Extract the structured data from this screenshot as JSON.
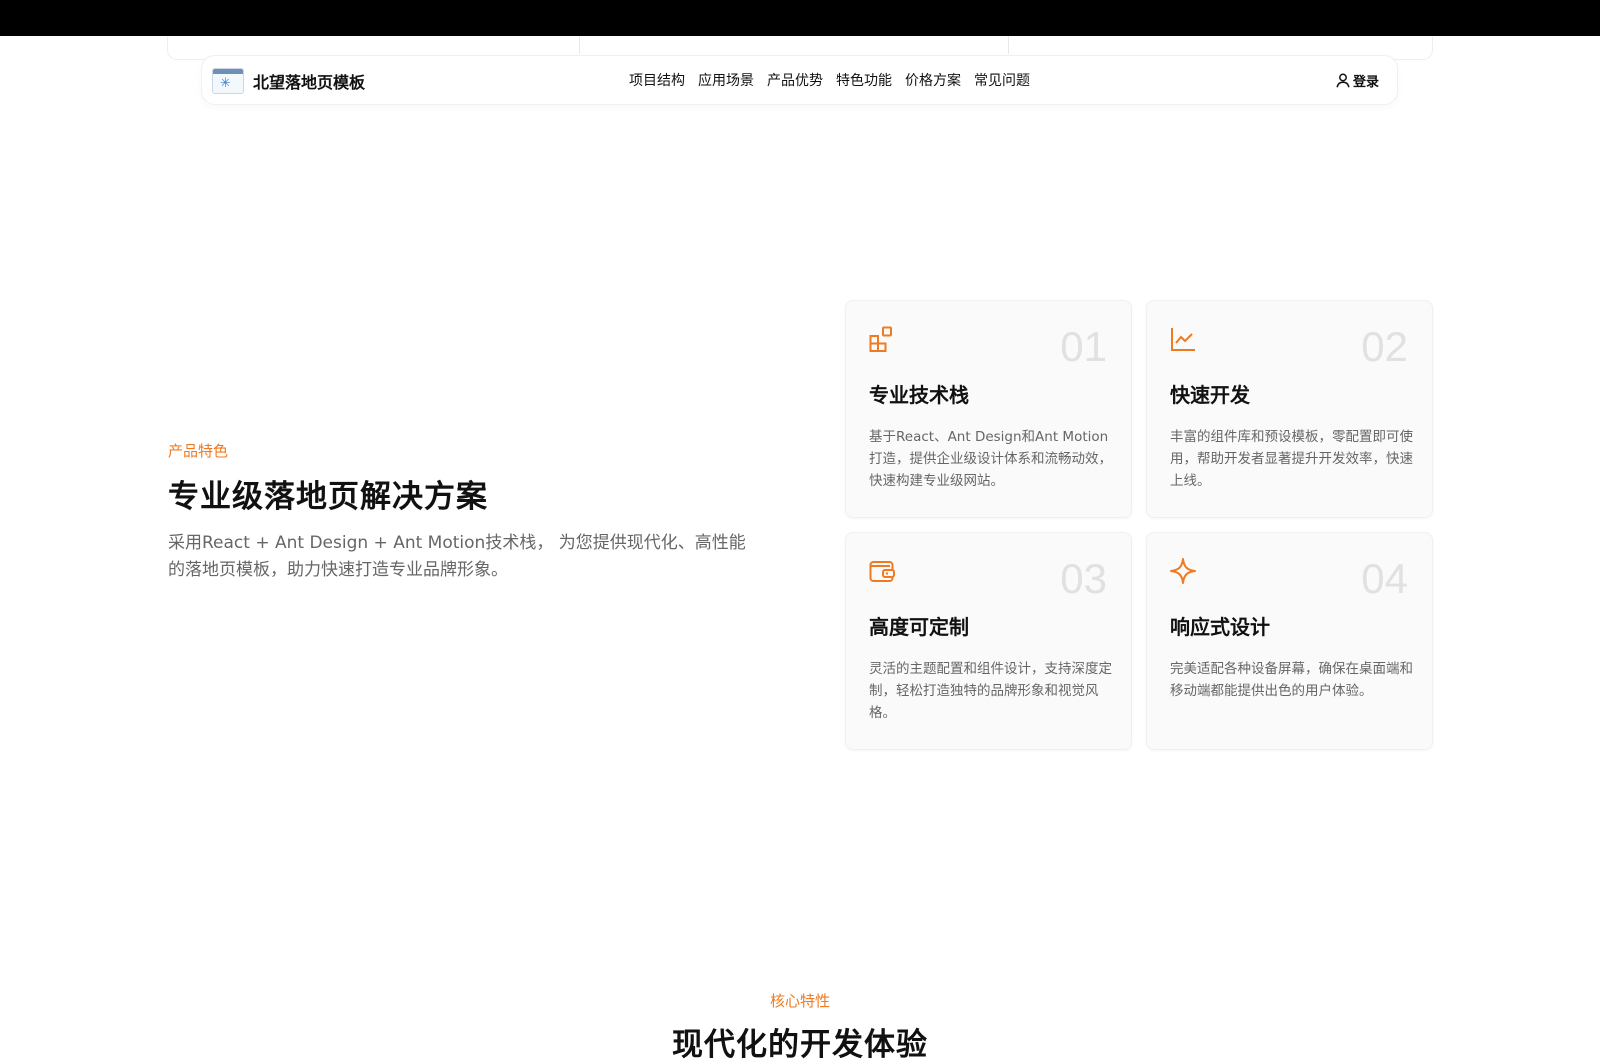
{
  "brand": {
    "name": "北望落地页模板"
  },
  "nav": {
    "links": [
      {
        "label": "项目结构"
      },
      {
        "label": "应用场景"
      },
      {
        "label": "产品优势"
      },
      {
        "label": "特色功能"
      },
      {
        "label": "价格方案"
      },
      {
        "label": "常见问题"
      }
    ],
    "login_label": "登录"
  },
  "features": {
    "eyebrow": "产品特色",
    "title": "专业级落地页解决方案",
    "description": "采用React + Ant Design + Ant Motion技术栈， 为您提供现代化、高性能的落地页模板，助力快速打造专业品牌形象。",
    "cards": [
      {
        "number": "01",
        "icon": "blocks-icon",
        "title": "专业技术栈",
        "description": "基于React、Ant Design和Ant Motion打造，提供企业级设计体系和流畅动效，快速构建专业级网站。"
      },
      {
        "number": "02",
        "icon": "line-chart-icon",
        "title": "快速开发",
        "description": "丰富的组件库和预设模板，零配置即可使用，帮助开发者显著提升开发效率，快速上线。"
      },
      {
        "number": "03",
        "icon": "wallet-icon",
        "title": "高度可定制",
        "description": "灵活的主题配置和组件设计，支持深度定制，轻松打造独特的品牌形象和视觉风格。"
      },
      {
        "number": "04",
        "icon": "sparkle-icon",
        "title": "响应式设计",
        "description": "完美适配各种设备屏幕，确保在桌面端和移动端都能提供出色的用户体验。"
      }
    ]
  },
  "core": {
    "eyebrow": "核心特性",
    "title": "现代化的开发体验"
  },
  "colors": {
    "accent": "#f07a21",
    "text": "#111111",
    "muted": "#666666",
    "card_bg": "#fafafa",
    "number": "#e1e1e1"
  }
}
